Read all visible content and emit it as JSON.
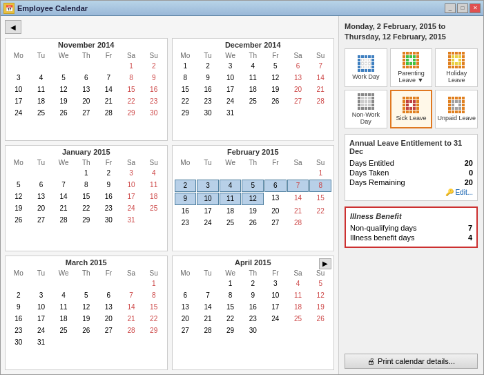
{
  "window": {
    "title": "Employee Calendar",
    "icon": "📅"
  },
  "header": {
    "date_range": "Monday, 2 February, 2015 to\nThursday, 12 February, 2015"
  },
  "leave_buttons": [
    {
      "id": "work-day",
      "label": "Work Day",
      "color": "blue",
      "selected": false
    },
    {
      "id": "parenting-leave",
      "label": "Parenting Leave ▼",
      "color": "orange",
      "selected": false
    },
    {
      "id": "holiday-leave",
      "label": "Holiday Leave",
      "color": "orange",
      "selected": false
    },
    {
      "id": "non-work-day",
      "label": "Non-Work Day",
      "color": "gray",
      "selected": false
    },
    {
      "id": "sick-leave",
      "label": "Sick Leave",
      "color": "orange",
      "selected": true
    },
    {
      "id": "unpaid-leave",
      "label": "Unpaid Leave",
      "color": "orange",
      "selected": false
    }
  ],
  "annual_leave": {
    "title": "Annual Leave Entitlement to 31 Dec",
    "days_entitled_label": "Days Entitled",
    "days_entitled_value": "20",
    "days_taken_label": "Days Taken",
    "days_taken_value": "0",
    "days_remaining_label": "Days Remaining",
    "days_remaining_value": "20",
    "edit_label": "Edit..."
  },
  "illness_benefit": {
    "title": "Illness Benefit",
    "non_qualifying_label": "Non-qualifying days",
    "non_qualifying_value": "7",
    "illness_days_label": "Illness benefit days",
    "illness_days_value": "4"
  },
  "print_button": "🖨 Print calendar details...",
  "months": [
    {
      "name": "November 2014",
      "headers": [
        "Mo",
        "Tu",
        "We",
        "Th",
        "Fr",
        "Sa",
        "Su"
      ],
      "days": [
        [
          null,
          null,
          null,
          null,
          null,
          1,
          2
        ],
        [
          3,
          4,
          5,
          6,
          7,
          8,
          9
        ],
        [
          10,
          11,
          12,
          13,
          14,
          15,
          16
        ],
        [
          17,
          18,
          19,
          20,
          21,
          22,
          23
        ],
        [
          24,
          25,
          26,
          27,
          28,
          29,
          30
        ]
      ]
    },
    {
      "name": "December 2014",
      "headers": [
        "Mo",
        "Tu",
        "We",
        "Th",
        "Fr",
        "Sa",
        "Su"
      ],
      "days": [
        [
          1,
          2,
          3,
          4,
          5,
          6,
          7
        ],
        [
          8,
          9,
          10,
          11,
          12,
          13,
          14
        ],
        [
          15,
          16,
          17,
          18,
          19,
          20,
          21
        ],
        [
          22,
          23,
          24,
          25,
          26,
          27,
          28
        ],
        [
          29,
          30,
          31,
          null,
          null,
          null,
          null
        ]
      ]
    },
    {
      "name": "January 2015",
      "headers": [
        "Mo",
        "Tu",
        "We",
        "Th",
        "Fr",
        "Sa",
        "Su"
      ],
      "days": [
        [
          null,
          null,
          null,
          1,
          2,
          3,
          4
        ],
        [
          5,
          6,
          7,
          8,
          9,
          10,
          11
        ],
        [
          12,
          13,
          14,
          15,
          16,
          17,
          18
        ],
        [
          19,
          20,
          21,
          22,
          23,
          24,
          25
        ],
        [
          26,
          27,
          28,
          29,
          30,
          31,
          null
        ]
      ]
    },
    {
      "name": "February 2015",
      "headers": [
        "Mo",
        "Tu",
        "We",
        "Th",
        "Fr",
        "Sa",
        "Su"
      ],
      "days": [
        [
          null,
          null,
          null,
          null,
          null,
          null,
          1
        ],
        [
          2,
          3,
          4,
          5,
          6,
          7,
          8
        ],
        [
          9,
          10,
          11,
          12,
          13,
          14,
          15
        ],
        [
          16,
          17,
          18,
          19,
          20,
          21,
          22
        ],
        [
          23,
          24,
          25,
          26,
          27,
          28,
          null
        ]
      ],
      "selected_range": [
        [
          2,
          1
        ],
        [
          3,
          1
        ],
        [
          4,
          1
        ],
        [
          5,
          1
        ],
        [
          6,
          1
        ],
        [
          7,
          1
        ],
        [
          8,
          1
        ],
        [
          2,
          2
        ],
        [
          3,
          2
        ],
        [
          4,
          2
        ],
        [
          5,
          2
        ]
      ]
    },
    {
      "name": "March 2015",
      "headers": [
        "Mo",
        "Tu",
        "We",
        "Th",
        "Fr",
        "Sa",
        "Su"
      ],
      "days": [
        [
          null,
          null,
          null,
          null,
          null,
          null,
          1
        ],
        [
          2,
          3,
          4,
          5,
          6,
          7,
          8
        ],
        [
          9,
          10,
          11,
          12,
          13,
          14,
          15
        ],
        [
          16,
          17,
          18,
          19,
          20,
          21,
          22
        ],
        [
          23,
          24,
          25,
          26,
          27,
          28,
          29
        ],
        [
          30,
          31,
          null,
          null,
          null,
          null,
          null
        ]
      ]
    },
    {
      "name": "April 2015",
      "headers": [
        "Mo",
        "Tu",
        "We",
        "Th",
        "Fr",
        "Sa",
        "Su"
      ],
      "days": [
        [
          null,
          null,
          1,
          2,
          3,
          4,
          5
        ],
        [
          6,
          7,
          8,
          9,
          10,
          11,
          12
        ],
        [
          13,
          14,
          15,
          16,
          17,
          18,
          19
        ],
        [
          20,
          21,
          22,
          23,
          24,
          25,
          26
        ],
        [
          27,
          28,
          29,
          30,
          null,
          null,
          null
        ]
      ]
    }
  ]
}
